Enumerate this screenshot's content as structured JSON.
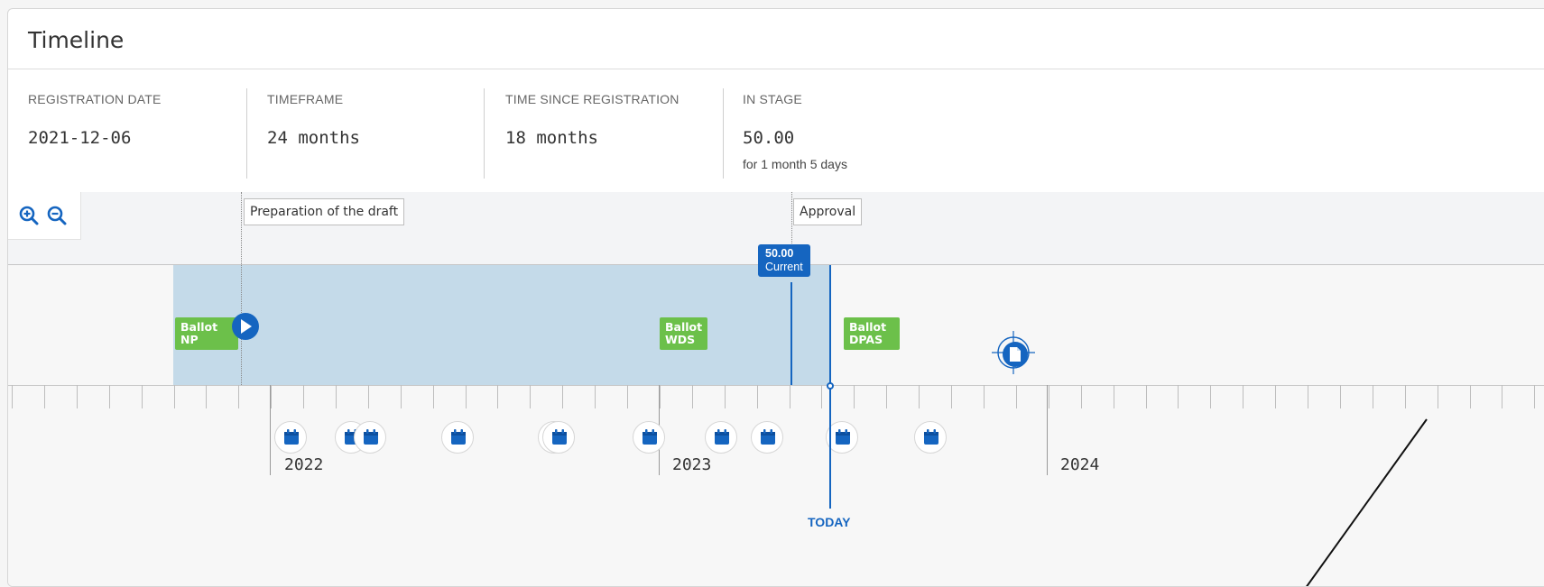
{
  "panel": {
    "title": "Timeline"
  },
  "stats": [
    {
      "label": "REGISTRATION DATE",
      "value": "2021-12-06",
      "sub": ""
    },
    {
      "label": "TIMEFRAME",
      "value": "24 months",
      "sub": ""
    },
    {
      "label": "TIME SINCE REGISTRATION",
      "value": "18 months",
      "sub": ""
    },
    {
      "label": "IN STAGE",
      "value": "50.00",
      "sub": "for 1 month 5 days"
    }
  ],
  "toolbar": {
    "zoom_in_icon": "zoom-in-icon",
    "zoom_out_icon": "zoom-out-icon"
  },
  "stages": [
    {
      "label": "Preparation of the draft"
    },
    {
      "label": "Approval"
    }
  ],
  "current": {
    "value": "50.00",
    "label": "Current"
  },
  "ballots": [
    {
      "line1": "Ballot",
      "line2": "NP"
    },
    {
      "line1": "Ballot",
      "line2": "WDS"
    },
    {
      "line1": "Ballot",
      "line2": "DPAS"
    }
  ],
  "years": [
    "2022",
    "2023",
    "2024"
  ],
  "today": {
    "label": "TODAY"
  },
  "colors": {
    "accent": "#1565c0",
    "ballot": "#6cc04a",
    "range": "#c4dae9"
  }
}
